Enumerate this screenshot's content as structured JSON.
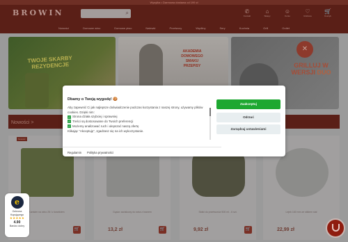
{
  "topbar": {
    "text": "Wysyłka • Darmowa dostawa od 199 zł"
  },
  "header": {
    "logo": "BROWIN",
    "icons": [
      {
        "icon": "phone-icon",
        "glyph": "✆",
        "label": "Kontakt"
      },
      {
        "icon": "store-icon",
        "glyph": "⌂",
        "label": "Sklepy"
      },
      {
        "icon": "user-icon",
        "glyph": "☺",
        "label": "Konto"
      },
      {
        "icon": "heart-icon",
        "glyph": "♡",
        "label": "Ulubione"
      },
      {
        "icon": "cart-icon",
        "glyph": "🛒",
        "label": "Koszyk"
      }
    ]
  },
  "nav": {
    "items": [
      "Nowości",
      "Domowe wino",
      "Domowe piwo",
      "Nalewki",
      "Przetwory",
      "Wędliny",
      "Sery",
      "Kuchnia",
      "Grill",
      "Outlet"
    ]
  },
  "banners": [
    {
      "title": "TWOJE SKARBY REZYDENCJE"
    },
    {
      "title": "AKADEMIA DOMOWEGO SMAKU PRZEPISY"
    },
    {
      "title": "GRILLUJ W WERSJI",
      "highlight": "DUO"
    }
  ],
  "section": {
    "title": "Nowości >"
  },
  "products": [
    {
      "badge": "Nowość",
      "name": "Kanister na wino 25 l z kranikiem",
      "price": "",
      "cart": "🛒"
    },
    {
      "badge": "",
      "name": "Gąsior zaciskowy do wina z kranem",
      "price": "13,2 zł",
      "cart": "🛒"
    },
    {
      "badge": "",
      "name": "Słoiki do przetworów 500 ml - 6 szt.",
      "price": "9,92 zł",
      "cart": "🛒"
    },
    {
      "badge": "",
      "name": "Lejek 160 mm ze sitkiem stal",
      "price": "22,99 zł",
      "cart": "🛒"
    }
  ],
  "trust": {
    "label1": "Ochrona",
    "label2": "Kupującego",
    "stars": "★★★★★",
    "score": "4.90",
    "quality": "Bardzo dobry"
  },
  "cookie": {
    "title": "Dbamy o Twoją wygodę! 🍪",
    "intro": "Aby zapewnić Ci jak najlepsze doświadczenie podczas korzystania z naszej strony, używamy plików cookies. Dzięki nim:",
    "points": [
      "Strona działa szybciej i sprawniej",
      "Treści są dostosowane do Twoich preferencji",
      "Możemy analizować ruch i ulepszać naszą ofertę"
    ],
    "outro": "Klikając \"Akceptuję\", zgadzasz się na ich wykorzystanie.",
    "links": [
      "Regulamin",
      "Polityka prywatności"
    ],
    "accept": "Zaakceptuj",
    "reject": "Odrzuć",
    "manage": "Zarządzaj ustawieniami"
  }
}
